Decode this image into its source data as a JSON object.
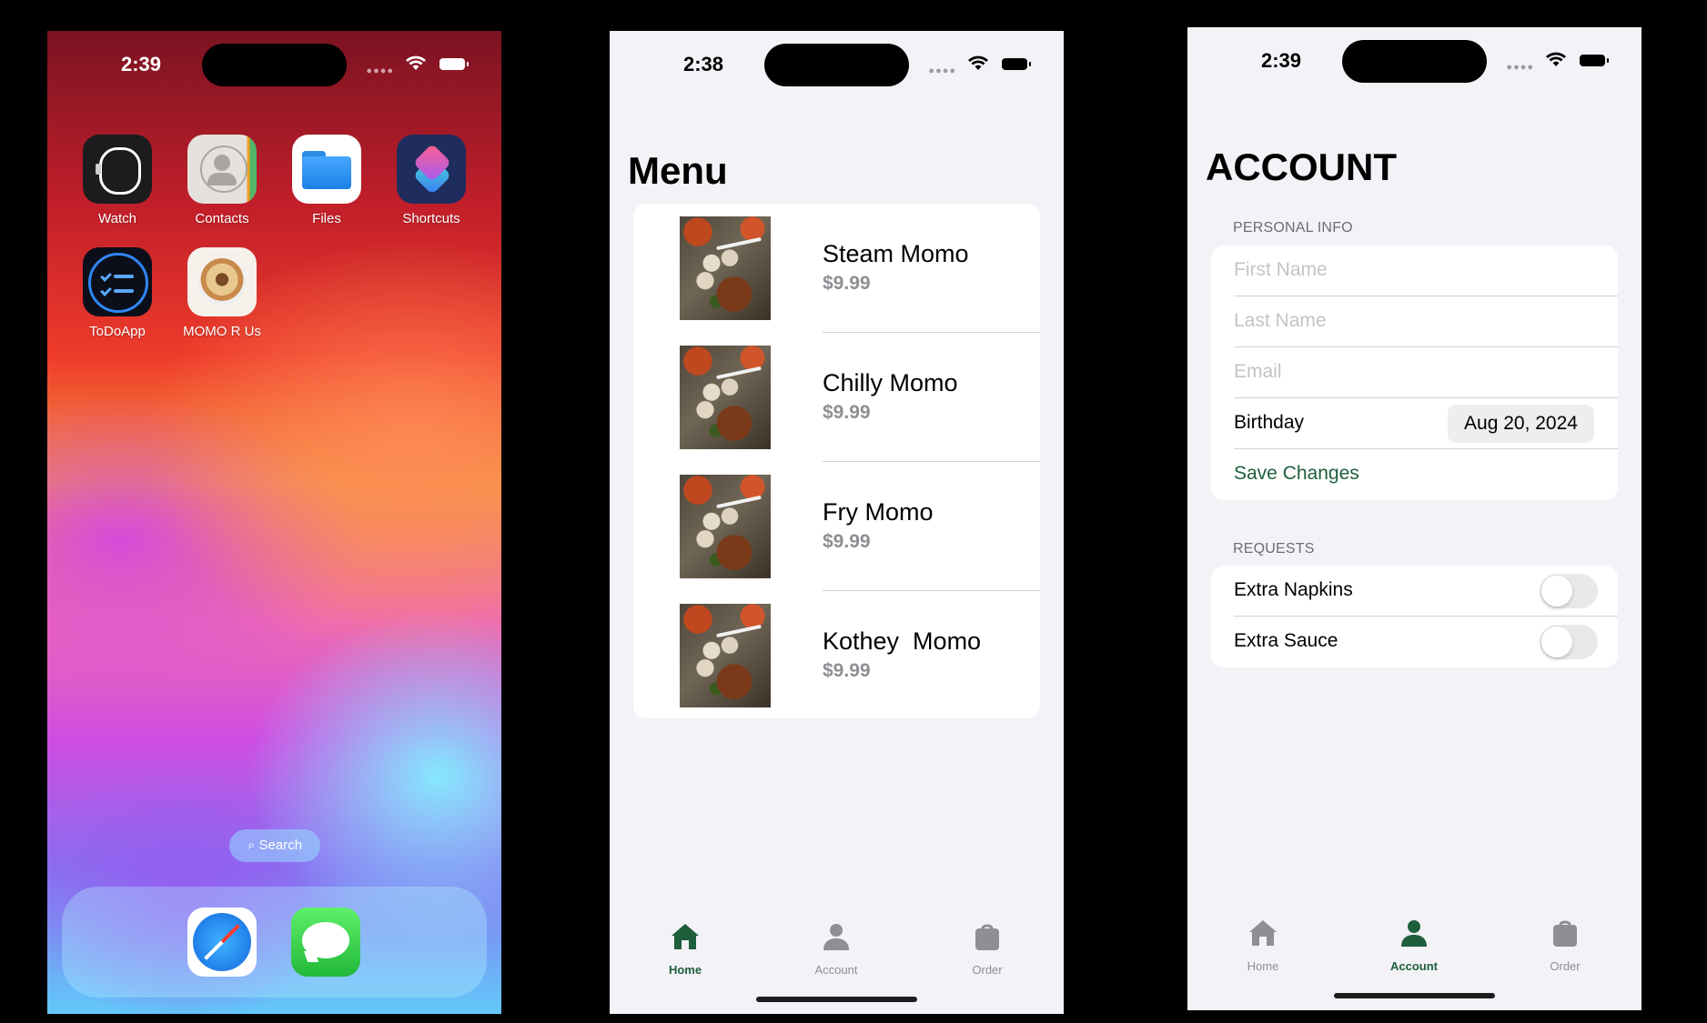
{
  "colors": {
    "accent_green": "#1e5e3b",
    "tab_inactive": "#8e8e93",
    "text_gray": "#8e8e93"
  },
  "home": {
    "time": "2:39",
    "apps": [
      {
        "label": "Watch",
        "icon": "watch-icon"
      },
      {
        "label": "Contacts",
        "icon": "contacts-icon"
      },
      {
        "label": "Files",
        "icon": "files-icon"
      },
      {
        "label": "Shortcuts",
        "icon": "shortcuts-icon"
      },
      {
        "label": "ToDoApp",
        "icon": "todo-icon"
      },
      {
        "label": "MOMO R Us",
        "icon": "momo-icon"
      }
    ],
    "search_label": "Search",
    "dock": [
      {
        "icon": "safari-icon"
      },
      {
        "icon": "messages-icon"
      }
    ]
  },
  "menu_screen": {
    "time": "2:38",
    "title": "Menu",
    "items": [
      {
        "name": "Steam Momo",
        "price": "$9.99"
      },
      {
        "name": "Chilly Momo",
        "price": "$9.99"
      },
      {
        "name": "Fry Momo",
        "price": "$9.99"
      },
      {
        "name": "Kothey  Momo",
        "price": "$9.99"
      }
    ]
  },
  "account_screen": {
    "time": "2:39",
    "title": "ACCOUNT",
    "personal_header": "PERSONAL INFO",
    "first_name_placeholder": "First Name",
    "last_name_placeholder": "Last Name",
    "email_placeholder": "Email",
    "birthday_label": "Birthday",
    "birthday_value": "Aug 20, 2024",
    "save_label": "Save Changes",
    "requests_header": "REQUESTS",
    "extra_napkins_label": "Extra Napkins",
    "extra_napkins_on": false,
    "extra_sauce_label": "Extra Sauce",
    "extra_sauce_on": false
  },
  "tabs": [
    {
      "label": "Home",
      "icon": "house-icon"
    },
    {
      "label": "Account",
      "icon": "person-icon"
    },
    {
      "label": "Order",
      "icon": "bag-icon"
    }
  ],
  "menu_active_tab": "Home",
  "account_active_tab": "Account"
}
